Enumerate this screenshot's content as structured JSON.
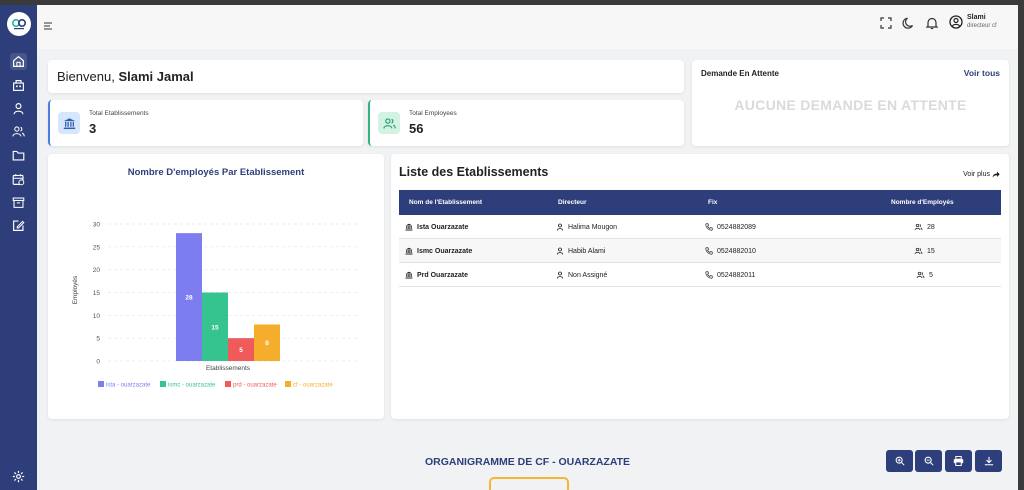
{
  "header": {
    "user_name": "Slami",
    "user_role": "directeur cf"
  },
  "welcome": {
    "greeting": "Bienvenu, ",
    "name": "Slami Jamal"
  },
  "stats": {
    "etablissements_label": "Total Etablissements",
    "etablissements_value": "3",
    "employees_label": "Total Employees",
    "employees_value": "56"
  },
  "pending": {
    "title": "Demande En Attente",
    "link": "Voir tous",
    "empty": "AUCUNE DEMANDE EN ATTENTE"
  },
  "chart_data": {
    "type": "bar",
    "title": "Nombre D'employés Par Etablissement",
    "xlabel": "Etablissements",
    "ylabel": "Employés",
    "ylim": [
      0,
      30
    ],
    "yticks": [
      "0",
      "5",
      "10",
      "15",
      "20",
      "25",
      "30"
    ],
    "grid": true,
    "legend": "bottom",
    "series": [
      {
        "name": "ista - ouarzazate",
        "value": 28,
        "color": "#7c7ef0"
      },
      {
        "name": "ismc - ouarzazate",
        "value": 15,
        "color": "#35c38f"
      },
      {
        "name": "prd - ouarzazate",
        "value": 5,
        "color": "#f05a5a"
      },
      {
        "name": "cf - ouarzazate",
        "value": 8,
        "color": "#f5ad2c"
      }
    ]
  },
  "list": {
    "title": "Liste des Etablissements",
    "voir_plus": "Voir plus",
    "headers": [
      "Nom de l'Etablissement",
      "Directeur",
      "Fix",
      "Nombre d'Employés"
    ],
    "rows": [
      {
        "name": "Ista Ouarzazate",
        "director": "Halima Mougon",
        "fix": "0524882089",
        "count": "28"
      },
      {
        "name": "Ismc Ouarzazate",
        "director": "Habib Alami",
        "fix": "0524882010",
        "count": "15"
      },
      {
        "name": "Prd Ouarzazate",
        "director": "Non Assigné",
        "fix": "0524882011",
        "count": "5"
      }
    ]
  },
  "organigramme": {
    "title": "ORGANIGRAMME DE CF - OUARZAZATE"
  },
  "colors": {
    "sidebar": "#2d3e7a",
    "accent": "#2d3e7a"
  }
}
